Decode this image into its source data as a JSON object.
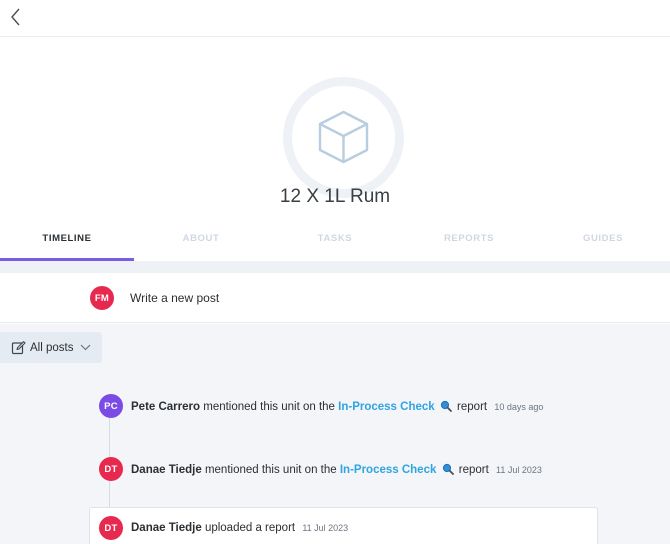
{
  "header": {
    "back_icon": "chevron-left-icon"
  },
  "unit": {
    "icon": "cube-icon",
    "title": "12 X 1L Rum"
  },
  "tabs": [
    {
      "label": "TIMELINE",
      "active": true
    },
    {
      "label": "ABOUT",
      "active": false
    },
    {
      "label": "TASKS",
      "active": false
    },
    {
      "label": "REPORTS",
      "active": false
    },
    {
      "label": "GUIDES",
      "active": false
    }
  ],
  "compose": {
    "avatar_initials": "FM",
    "avatar_color": "#e8294f",
    "placeholder": "Write a new post"
  },
  "filter": {
    "icon": "edit-icon",
    "label": "All posts",
    "chevron": "chevron-down-icon"
  },
  "timeline": [
    {
      "initials": "PC",
      "avatar_color": "#7b4be6",
      "name": "Pete Carrero",
      "text_before": " mentioned this unit on the ",
      "link": "In-Process Check",
      "link_icon": "search-icon",
      "text_after": " report",
      "time": "10 days ago"
    },
    {
      "initials": "DT",
      "avatar_color": "#e8294f",
      "name": "Danae Tiedje",
      "text_before": " mentioned this unit on the ",
      "link": "In-Process Check",
      "link_icon": "search-icon",
      "text_after": " report",
      "time": "11 Jul 2023"
    },
    {
      "initials": "DT",
      "avatar_color": "#e8294f",
      "name": "Danae Tiedje",
      "text_before": " uploaded a report",
      "time": "11 Jul 2023"
    }
  ],
  "colors": {
    "accent": "#7b5ce6",
    "link": "#2fa4e0",
    "feed_bg": "#f3f5f8"
  }
}
